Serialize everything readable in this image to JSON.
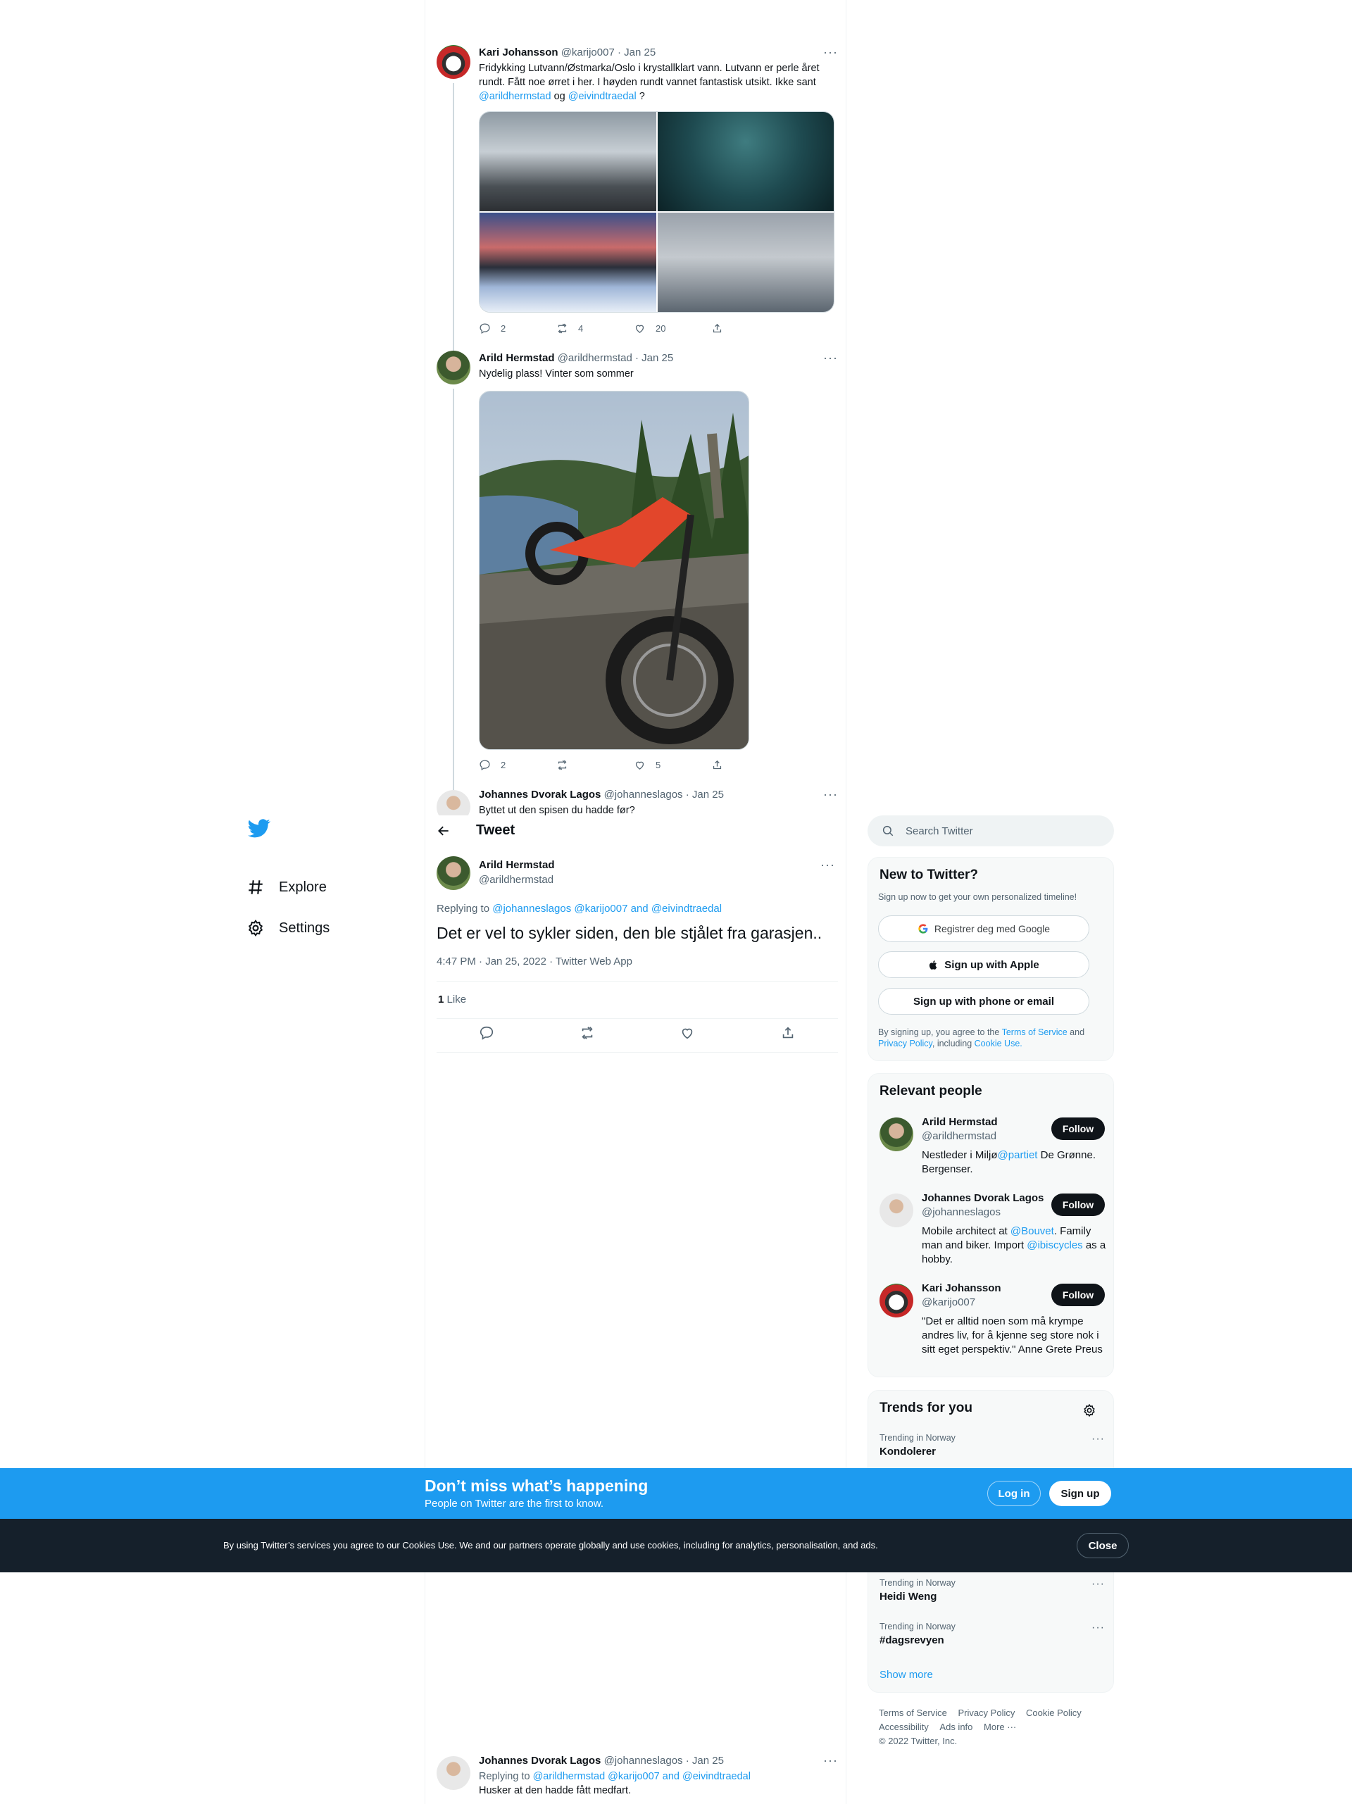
{
  "colors": {
    "accent": "#1d9bf0",
    "text": "#0f1419",
    "muted": "#536471",
    "banner": "#1d9bf0",
    "cookie_bg": "#15202b"
  },
  "nav": {
    "logo_icon": "twitter-bird-icon",
    "items": [
      {
        "label": "Explore",
        "icon": "hashtag-icon"
      },
      {
        "label": "Settings",
        "icon": "gear-icon"
      }
    ]
  },
  "thread": [
    {
      "name": "Kari Johansson",
      "handle": "@karijo007",
      "date": "Jan 25",
      "text_lines": [
        "Fridykking Lutvann/Østmarka/Oslo i krystallklart vann. Lutvann er perle året",
        "rundt. Fått noe ørret i her. I høyden rundt vannet fantastisk utsikt. Ikke sant"
      ],
      "mention_1": "@arildhermstad",
      "joiner": "og",
      "mention_2": "@eivindtraedal",
      "end": "?",
      "replies": "2",
      "retweets": "4",
      "likes": "20"
    },
    {
      "name": "Arild Hermstad",
      "handle": "@arildhermstad",
      "date": "Jan 25",
      "text": "Nydelig plass! Vinter som sommer",
      "replies": "2",
      "retweets": "",
      "likes": "5"
    },
    {
      "name": "Johannes Dvorak Lagos",
      "handle": "@johanneslagos",
      "date": "Jan 25",
      "text": "Byttet ut den spisen du hadde før?"
    }
  ],
  "header": {
    "title": "Tweet"
  },
  "main_tweet": {
    "name": "Arild Hermstad",
    "handle": "@arildhermstad",
    "replying_label": "Replying to",
    "replying_to": "@johanneslagos @karijo007 and @eivindtraedal",
    "text": "Det er vel to sykler siden, den ble stjålet fra garasjen..",
    "meta": "4:47 PM · Jan 25, 2022 · Twitter Web App",
    "like_count": "1",
    "like_label": "Like"
  },
  "last_reply": {
    "name": "Johannes Dvorak Lagos",
    "handle": "@johanneslagos",
    "date": "Jan 25",
    "replying_label": "Replying to",
    "replying_to": "@arildhermstad @karijo007 and @eivindtraedal",
    "text": "Husker at den hadde fått medfart."
  },
  "search": {
    "placeholder": "Search Twitter"
  },
  "signup_card": {
    "title": "New to Twitter?",
    "subtitle": "Sign up now to get your own personalized timeline!",
    "google": "Registrer deg med Google",
    "apple": "Sign up with Apple",
    "phone": "Sign up with phone or email",
    "legal_1": "By signing up, you agree to the",
    "tos": "Terms of Service",
    "and": "and",
    "privacy": "Privacy Policy",
    "including": ", including",
    "cookie": "Cookie Use."
  },
  "relevant": {
    "title": "Relevant people",
    "follow_label": "Follow",
    "people": [
      {
        "name": "Arild Hermstad",
        "handle": "@arildhermstad",
        "bio_1": "Nestleder i Miljø",
        "bio_link": "@partiet",
        "bio_2": " De Grønne. Bergenser."
      },
      {
        "name": "Johannes Dvorak Lagos",
        "handle": "@johanneslagos",
        "bio_1": "Mobile architect at ",
        "bio_link": "@Bouvet",
        "bio_2": ". Family man and biker. Import ",
        "bio_link_2": "@ibiscycles",
        "bio_3": " as a hobby."
      },
      {
        "name": "Kari Johansson",
        "handle": "@karijo007",
        "bio": "\"Det er alltid noen som må krympe andres liv, for å kjenne seg store nok i sitt eget perspektiv.\" Anne Grete Preus"
      }
    ]
  },
  "trends": {
    "title": "Trends for you",
    "items": [
      {
        "context": "Trending in Norway",
        "name": "Kondolerer"
      },
      {
        "context": "Trending in Norway",
        "name": "Heidi Weng"
      },
      {
        "context": "Trending in Norway",
        "name": "#dagsrevyen"
      }
    ],
    "show_more": "Show more"
  },
  "footer": {
    "links": [
      "Terms of Service",
      "Privacy Policy",
      "Cookie Policy",
      "Accessibility",
      "Ads info",
      "More ···"
    ],
    "copyright": "© 2022 Twitter, Inc."
  },
  "banner": {
    "title": "Don’t miss what’s happening",
    "subtitle": "People on Twitter are the first to know.",
    "login": "Log in",
    "signup": "Sign up"
  },
  "cookie_bar": {
    "text": "By using Twitter’s services you agree to our Cookies Use. We and our partners operate globally and use cookies, including for analytics, personalisation, and ads.",
    "close": "Close"
  }
}
